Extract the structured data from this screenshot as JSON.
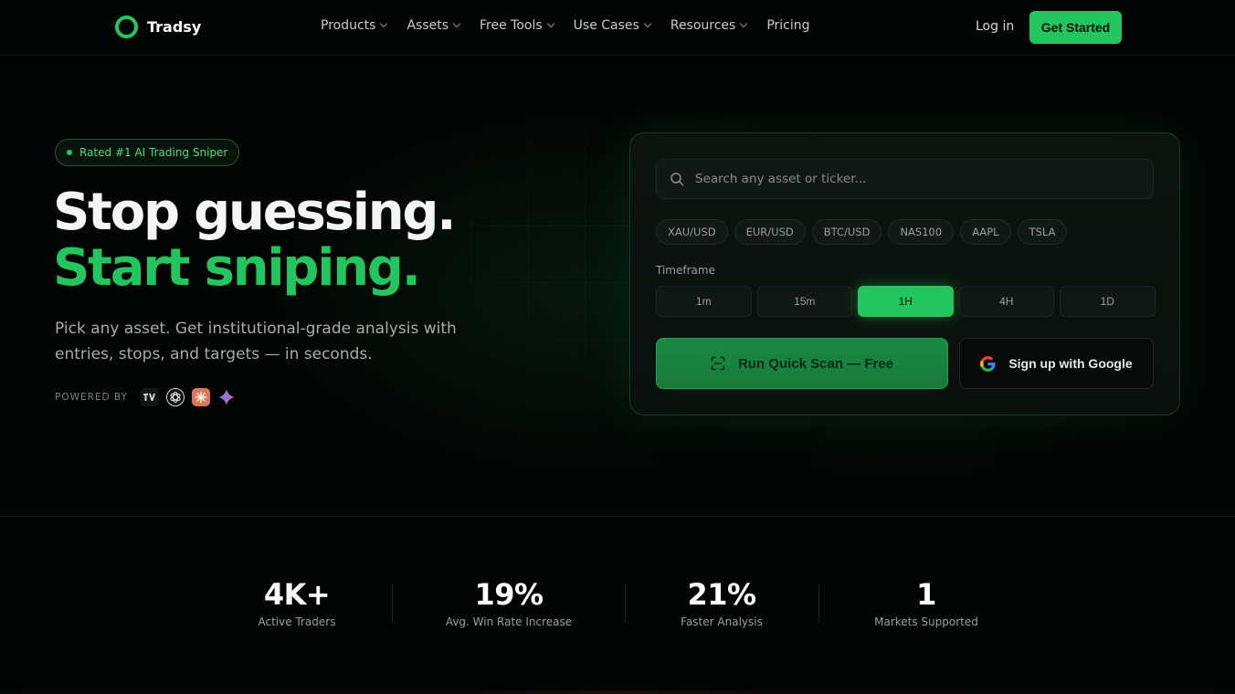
{
  "nav": {
    "brand": "Tradsy",
    "menu": [
      {
        "label": "Products",
        "dropdown": true
      },
      {
        "label": "Assets",
        "dropdown": true
      },
      {
        "label": "Free Tools",
        "dropdown": true
      },
      {
        "label": "Use Cases",
        "dropdown": true
      },
      {
        "label": "Resources",
        "dropdown": true
      },
      {
        "label": "Pricing",
        "dropdown": false
      }
    ],
    "login_label": "Log in",
    "cta_label": "Get Started"
  },
  "hero": {
    "badge": "Rated #1 AI Trading Sniper",
    "headline_1": "Stop guessing.",
    "headline_2": "Start sniping.",
    "subtitle": "Pick any asset. Get institutional-grade analysis with entries, stops, and targets — in seconds.",
    "powered_by_label": "POWERED BY",
    "powered_by_icons": [
      "tradingview-icon",
      "openai-icon",
      "claude-icon",
      "gemini-icon"
    ]
  },
  "scanner": {
    "search_placeholder": "Search any asset or ticker...",
    "search_value": "",
    "quick_assets": [
      "XAU/USD",
      "EUR/USD",
      "BTC/USD",
      "NAS100",
      "AAPL",
      "TSLA"
    ],
    "timeframe_label": "Timeframe",
    "timeframes": [
      "1m",
      "15m",
      "1H",
      "4H",
      "1D"
    ],
    "selected_timeframe": "1H",
    "run_label": "Run Quick Scan — Free",
    "google_label": "Sign up with Google"
  },
  "stats": [
    {
      "value": "4K+",
      "label": "Active Traders"
    },
    {
      "value": "19%",
      "label": "Avg. Win Rate Increase"
    },
    {
      "value": "21%",
      "label": "Faster Analysis"
    },
    {
      "value": "1",
      "label": "Markets Supported"
    }
  ],
  "colors": {
    "accent": "#22c55e",
    "background": "#030504",
    "panel": "#0c1410"
  }
}
